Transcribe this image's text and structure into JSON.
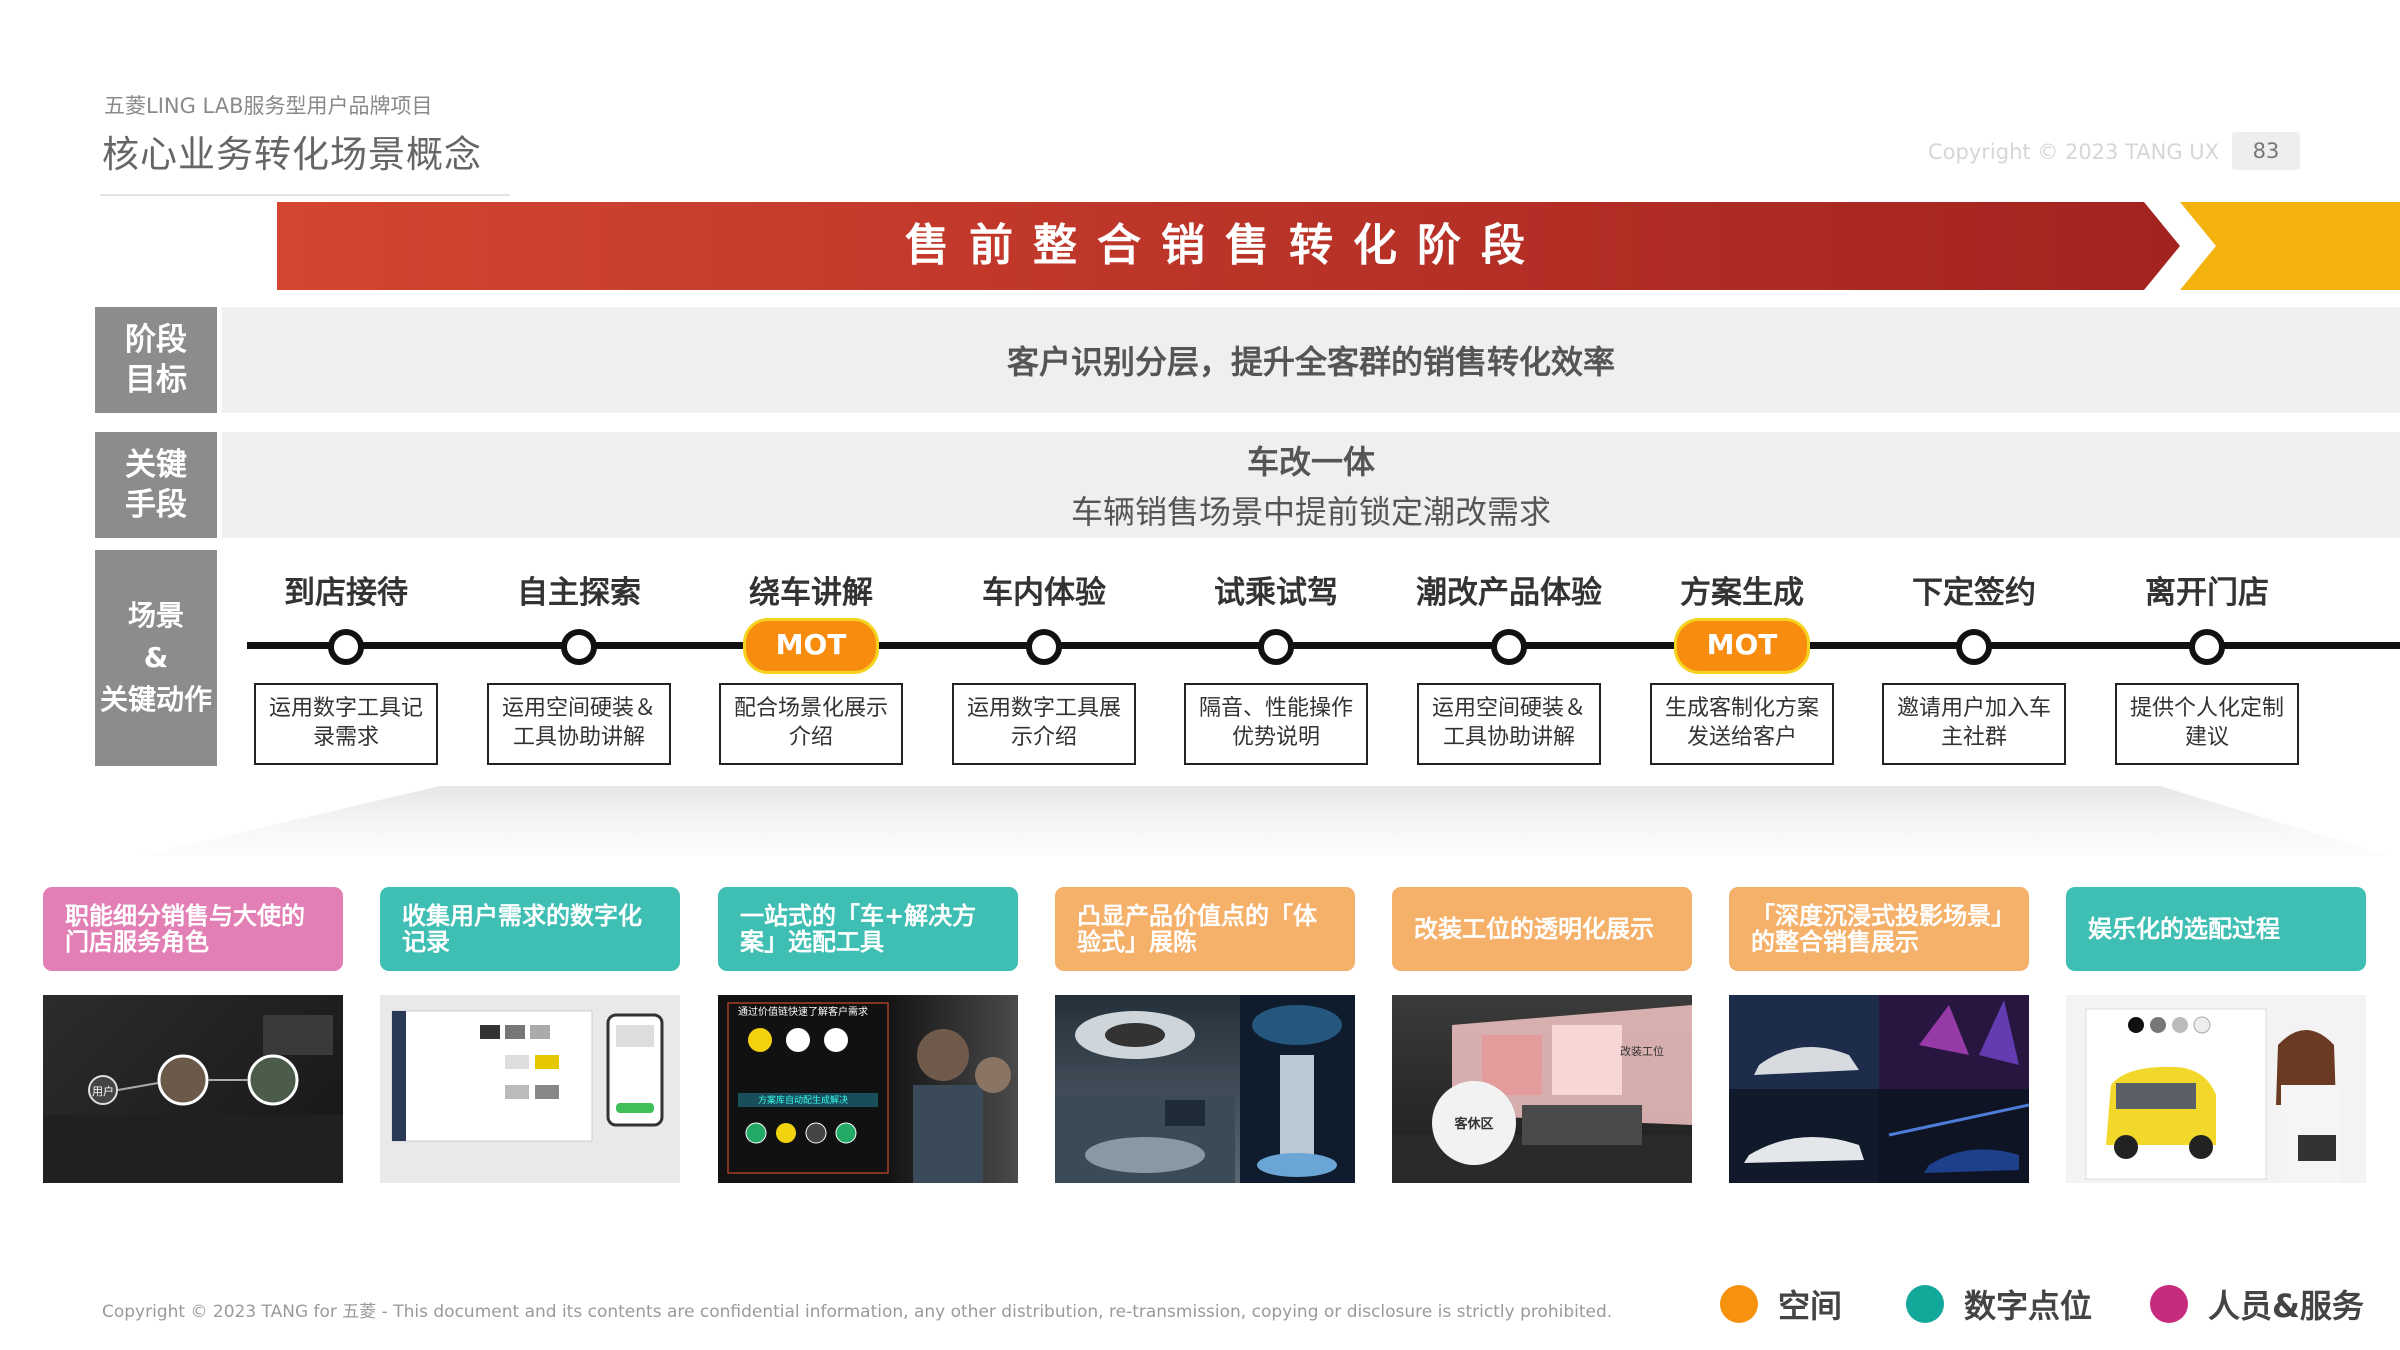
{
  "header": {
    "project": "五菱LING LAB服务型用户品牌项目",
    "title": "核心业务转化场景概念",
    "copyright": "Copyright © 2023 TANG UX",
    "page_number": "83"
  },
  "banner": {
    "title": "售前整合销售转化阶段"
  },
  "rows": {
    "goal": {
      "head": "阶段\n目标",
      "text": "客户识别分层，提升全客群的销售转化效率"
    },
    "means": {
      "head": "关键\n手段",
      "line1": "车改一体",
      "line2": "车辆销售场景中提前锁定潮改需求"
    },
    "scene": {
      "head_l1": "场景",
      "head_l2": "&",
      "head_l3": "关键动作"
    }
  },
  "stages": [
    {
      "name": "到店接待",
      "mot": false,
      "action": "运用数字工具记录需求"
    },
    {
      "name": "自主探索",
      "mot": false,
      "action": "运用空间硬装＆工具协助讲解"
    },
    {
      "name": "绕车讲解",
      "mot": true,
      "action": "配合场景化展示介绍"
    },
    {
      "name": "车内体验",
      "mot": false,
      "action": "运用数字工具展示介绍"
    },
    {
      "name": "试乘试驾",
      "mot": false,
      "action": "隔音、性能操作优势说明"
    },
    {
      "name": "潮改产品体验",
      "mot": false,
      "action": "运用空间硬装＆工具协助讲解"
    },
    {
      "name": "方案生成",
      "mot": true,
      "action": "生成客制化方案发送给客户"
    },
    {
      "name": "下定签约",
      "mot": false,
      "action": "邀请用户加入车主社群"
    },
    {
      "name": "离开门店",
      "mot": false,
      "action": "提供个人化定制建议"
    }
  ],
  "mot_label": "MOT",
  "concepts": [
    {
      "label": "职能细分销售与大使的门店服务角色",
      "color": "#e27fb5",
      "thumb": "staff-roles-photo"
    },
    {
      "label": "收集用户需求的数字化记录",
      "color": "#3fbfb3",
      "thumb": "digital-record-screens"
    },
    {
      "label": "一站式的「车+解决方案」选配工具",
      "color": "#3fbfb3",
      "thumb": "config-tool-photo"
    },
    {
      "label": "凸显产品价值点的「体验式」展陈",
      "color": "#f5b06a",
      "thumb": "experience-display-photo"
    },
    {
      "label": "改装工位的透明化展示",
      "color": "#f5b06a",
      "thumb": "workshop-lounge-photo"
    },
    {
      "label": "「深度沉浸式投影场景」的整合销售展示",
      "color": "#f5b06a",
      "thumb": "projection-scene-photo"
    },
    {
      "label": "娱乐化的选配过程",
      "color": "#3fbfb3",
      "thumb": "fun-config-photo"
    }
  ],
  "thumb_texts": {
    "t1_user": "用户",
    "t3_heading": "通过价值链快速了解客户需求",
    "t3_sub": "方案库自动配生成解决",
    "t5_lounge": "客休区",
    "t5_workshop": "改装工位"
  },
  "footer": {
    "text": "Copyright © 2023 TANG for 五菱 - This document and its contents are confidential information, any other distribution, re-transmission, copying or disclosure is strictly prohibited."
  },
  "legend": [
    {
      "label": "空间",
      "color": "#f7920f"
    },
    {
      "label": "数字点位",
      "color": "#12a89a"
    },
    {
      "label": "人员&服务",
      "color": "#c62b7e"
    }
  ],
  "colors": {
    "banner_start": "#d44532",
    "banner_end": "#a2231f",
    "banner_accent": "#f3b20d",
    "row_head": "#8c8c8c"
  }
}
